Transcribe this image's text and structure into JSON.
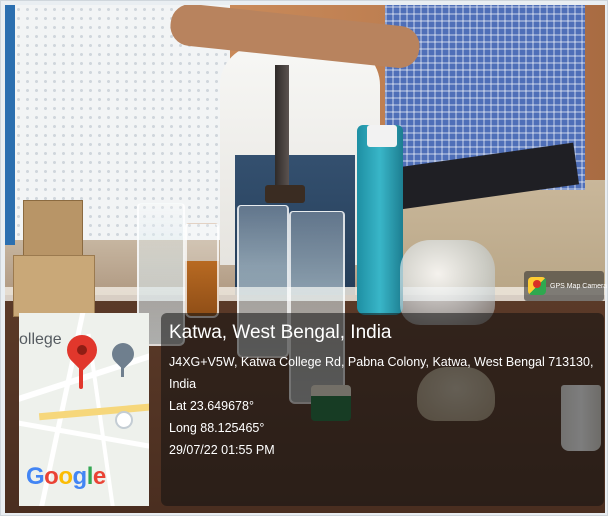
{
  "overlay": {
    "app_badge": "GPS Map Camera",
    "location_title": "Katwa, West Bengal, India",
    "address_line1": "J4XG+V5W, Katwa College Rd, Pabna Colony, Katwa, West Bengal 713130,",
    "address_line2": "India",
    "latitude": "Lat 23.649678°",
    "longitude": "Long 88.125465°",
    "timestamp": "29/07/22 01:55 PM"
  },
  "map": {
    "label_fragment": "ollege",
    "logo_letters": [
      "G",
      "o",
      "o",
      "g",
      "l",
      "e"
    ],
    "logo_colors": [
      "#4285F4",
      "#EA4335",
      "#FBBC05",
      "#4285F4",
      "#34A853",
      "#EA4335"
    ],
    "pin_color": "#e1372c",
    "icons": [
      "location-pin-icon",
      "college-pin-icon"
    ]
  }
}
